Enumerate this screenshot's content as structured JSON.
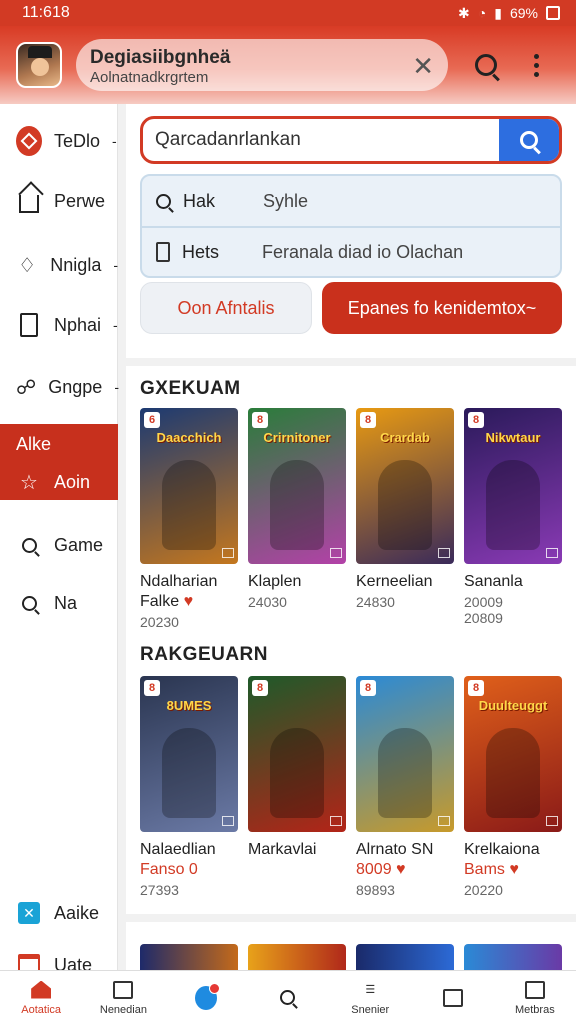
{
  "status_bar": {
    "time": "11:618",
    "battery": "69%"
  },
  "app_bar": {
    "title": "Degiasiibgnheä",
    "subtitle": "Aolnatnadkrgrtem",
    "close_label": "✕"
  },
  "sidebar": {
    "items": [
      {
        "label": "TeDlo",
        "icon": "tag-icon"
      },
      {
        "label": "Perwe",
        "icon": "home-icon"
      },
      {
        "label": "Nnigla",
        "icon": "bell-icon"
      },
      {
        "label": "Nphai",
        "icon": "tablet-icon"
      },
      {
        "label": "Gngpe",
        "icon": "controller-icon"
      },
      {
        "label": "Alke",
        "icon": "folder-icon"
      },
      {
        "label": "Aoin",
        "icon": "star-icon"
      },
      {
        "label": "Game",
        "icon": "search-icon"
      },
      {
        "label": "Na",
        "icon": "search-icon"
      },
      {
        "label": "Aaike",
        "icon": "app-icon"
      },
      {
        "label": "Uate",
        "icon": "calendar-icon"
      }
    ]
  },
  "search": {
    "value": "Qarcadanrlankan",
    "placeholder": "",
    "filters": [
      {
        "key": "Hak",
        "value": "Syhle"
      },
      {
        "key": "Hets",
        "value": "Feranala diad io Olachan"
      }
    ],
    "open_label": "Oon Afntalis",
    "primary_label": "Epanes fo kenidemtox~"
  },
  "sections": [
    {
      "title": "GXEKUAM",
      "games": [
        {
          "cover": "Daacchich",
          "name": "Ndalharian",
          "sub": "Falke",
          "meta": "20230",
          "badge": "6",
          "heart": true,
          "colors": [
            "#1c3a72",
            "#c4771e"
          ]
        },
        {
          "cover": "Crirnitoner",
          "name": "Klaplen",
          "sub": "",
          "meta": "24030",
          "badge": "8",
          "heart": false,
          "colors": [
            "#2a7d3a",
            "#b341a8"
          ]
        },
        {
          "cover": "Crardab",
          "name": "Kerneelian",
          "sub": "",
          "meta": "24830",
          "badge": "8",
          "heart": false,
          "colors": [
            "#e89a12",
            "#3a2a5a"
          ]
        },
        {
          "cover": "Nikwtaur",
          "name": "Sananla",
          "sub": "",
          "meta": "20009\n20809",
          "badge": "8",
          "heart": false,
          "colors": [
            "#2a1a5a",
            "#8a3ab5"
          ]
        }
      ]
    },
    {
      "title": "RAKGEUARN",
      "games": [
        {
          "cover": "8UMES",
          "name": "Nalaedlian",
          "sub": "Fanso 0",
          "meta": "27393",
          "badge": "8",
          "heart": false,
          "colors": [
            "#2a3550",
            "#6b7aa6"
          ]
        },
        {
          "cover": "",
          "name": "Markavlai",
          "sub": "",
          "meta": "",
          "badge": "8",
          "heart": false,
          "colors": [
            "#1e5a2a",
            "#b32418"
          ]
        },
        {
          "cover": "",
          "name": "Alrnato SN",
          "sub": "8009",
          "meta": "89893",
          "badge": "8",
          "heart": true,
          "colors": [
            "#2b8ad6",
            "#c89a2a"
          ]
        },
        {
          "cover": "Duulteuggt",
          "name": "Krelkaiona",
          "sub": "Bams",
          "meta": "20220",
          "badge": "8",
          "heart": true,
          "colors": [
            "#e0601a",
            "#8a1a18"
          ]
        }
      ]
    }
  ],
  "bottom_nav": [
    {
      "label": "Aotatica",
      "icon": "home-icon"
    },
    {
      "label": "Nenedian",
      "icon": "library-icon"
    },
    {
      "label": "",
      "icon": "notification-icon"
    },
    {
      "label": "",
      "icon": "search-icon"
    },
    {
      "label": "Snenier",
      "icon": "profile-icon"
    },
    {
      "label": "",
      "icon": "download-icon"
    },
    {
      "label": "Metbras",
      "icon": "menu-icon"
    }
  ]
}
